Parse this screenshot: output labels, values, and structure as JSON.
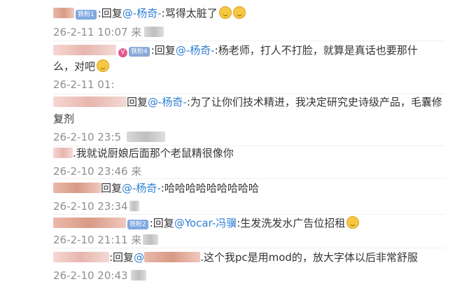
{
  "comments": [
    {
      "badge": "铁粉1",
      "reply": "回复",
      "mention": "@-杨奇-",
      "text": ":骂得太脏了",
      "time": "26-2-11 10:07 来"
    },
    {
      "badge": "铁粉4",
      "reply": "回复",
      "mention": "@-杨奇-",
      "text": ":杨老师，打人不打脸，就算是真话也要那什",
      "text2": "么，对吧",
      "time": "26-2-11 01:"
    },
    {
      "reply": "回复",
      "mention": "@-杨奇-",
      "text": ":为了让你们技术精进，我决定研究史诗级产品，毛囊修",
      "text2": "复剂",
      "time": "26-2-10 23:5"
    },
    {
      "text": ".我就说厨娘后面那个老鼠精很像你",
      "time": "26-2-10 23:46 来"
    },
    {
      "reply": "回复",
      "mention": "@-杨奇-",
      "text": ":哈哈哈哈哈哈哈哈哈",
      "time": "26-2-10 23:34"
    },
    {
      "badge": "铁粉2",
      "reply": "回复",
      "mention": "@Yocar-冯骥",
      "text": ":生发洗发水广告位招租",
      "time": "26-2-10 21:11 来"
    },
    {
      "reply": ":回复",
      "mention": "@",
      "text": ".这个我pc是用mod的，放大字体以后非常舒服",
      "time": "26-2-10 20:43"
    }
  ]
}
